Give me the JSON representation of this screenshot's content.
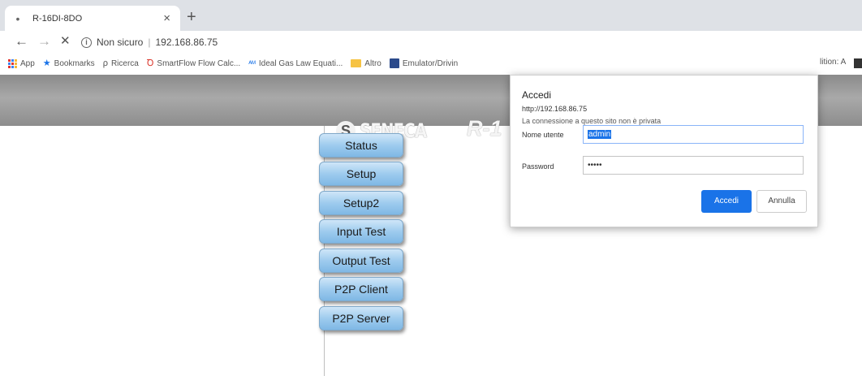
{
  "browser": {
    "tab": {
      "title": "R-16DI-8DO",
      "favicon": "dot-icon",
      "close": "×"
    },
    "new_tab": "+",
    "nav": {
      "back": "←",
      "forward": "→",
      "stop": "✕"
    },
    "address": {
      "security_icon": "info-icon",
      "security_symbol": "i",
      "security_text": "Non sicuro",
      "separator": "|",
      "url": "192.168.86.75"
    },
    "bookmarks": {
      "apps": "App",
      "bookmarks": "Bookmarks",
      "ricerca": "Ricerca",
      "smartflow": "SmartFlow Flow Calc...",
      "ideal_gas": "Ideal Gas Law Equati...",
      "altro": "Altro",
      "emulator": "Emulator/Drivin",
      "edition": "lition: A",
      "star_symbol": "★",
      "search_symbol": "ρ",
      "smartflow_symbol": "Ꝺ",
      "idealgas_symbol": "ᴬᴹ"
    }
  },
  "page": {
    "brand": "SENECA",
    "brand_mark": "S",
    "model": "R-1",
    "menu": [
      "Status",
      "Setup",
      "Setup2",
      "Input Test",
      "Output Test",
      "P2P Client",
      "P2P Server"
    ]
  },
  "dialog": {
    "title": "Accedi",
    "url": "http://192.168.86.75",
    "message": "La connessione a questo sito non è privata",
    "username_label": "Nome utente",
    "username_value": "admin",
    "password_label": "Password",
    "password_value": "•••••",
    "submit": "Accedi",
    "cancel": "Annulla"
  },
  "colors": {
    "accent": "#1a73e8",
    "header_gray": "#a9a9a9",
    "menu_button": "#9ecbee"
  }
}
